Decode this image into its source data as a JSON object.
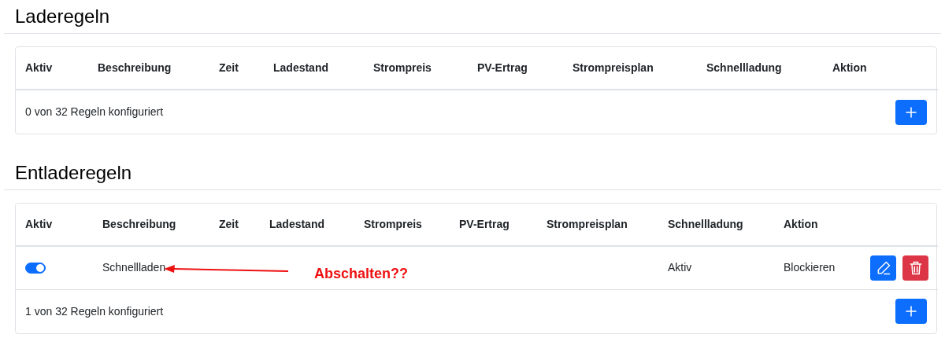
{
  "sections": [
    {
      "title": "Laderegeln",
      "columns": [
        "Aktiv",
        "Beschreibung",
        "Zeit",
        "Ladestand",
        "Strompreis",
        "PV-Ertrag",
        "Strompreisplan",
        "Schnellladung",
        "Aktion"
      ],
      "footer": "0 von 32 Regeln konfiguriert"
    },
    {
      "title": "Entladeregeln",
      "columns": [
        "Aktiv",
        "Beschreibung",
        "Zeit",
        "Ladestand",
        "Strompreis",
        "PV-Ertrag",
        "Strompreisplan",
        "Schnellladung",
        "Aktion"
      ],
      "rules": [
        {
          "active": true,
          "description": "Schnellladen",
          "fast_charging": "Aktiv",
          "action": "Blockieren"
        }
      ],
      "footer": "1 von 32 Regeln konfiguriert",
      "annotation": {
        "text": "Abschalten??"
      }
    }
  ]
}
